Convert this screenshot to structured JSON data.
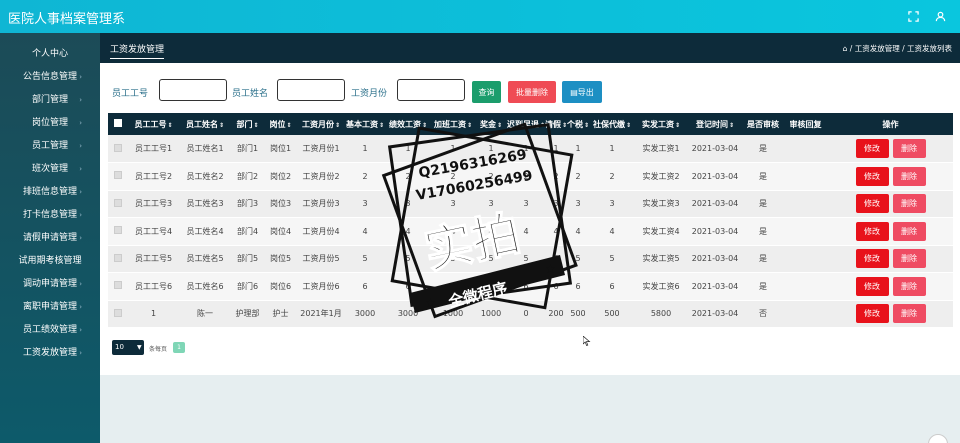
{
  "app": {
    "title": "医院人事档案管理系"
  },
  "sidebar": {
    "items": [
      {
        "label": "个人中心",
        "arrow": ""
      },
      {
        "label": "公告信息管理",
        "arrow": "›"
      },
      {
        "label": "部门管理",
        "arrow": "›"
      },
      {
        "label": "岗位管理",
        "arrow": "›"
      },
      {
        "label": "员工管理",
        "arrow": "›"
      },
      {
        "label": "班次管理",
        "arrow": "›"
      },
      {
        "label": "排班信息管理",
        "arrow": "›"
      },
      {
        "label": "打卡信息管理",
        "arrow": "›"
      },
      {
        "label": "请假申请管理",
        "arrow": "›"
      },
      {
        "label": "试用期考核管理",
        "arrow": "›"
      },
      {
        "label": "调动申请管理",
        "arrow": "›"
      },
      {
        "label": "离职申请管理",
        "arrow": "›"
      },
      {
        "label": "员工绩效管理",
        "arrow": "›"
      },
      {
        "label": "工资发放管理",
        "arrow": "›"
      }
    ]
  },
  "header": {
    "page_title": "工资发放管理",
    "breadcrumb": "⌂ / 工资发放管理 / 工资发放列表"
  },
  "search": {
    "emp_no_label": "员工工号",
    "emp_name_label": "员工姓名",
    "salary_month_label": "工资月份",
    "emp_no_value": "",
    "emp_name_value": "",
    "salary_month_value": "",
    "query_label": "查询",
    "batch_delete_label": "批量删除",
    "export_label": "导出",
    "export_icon": "document-icon"
  },
  "table": {
    "columns": [
      "员工工号",
      "员工姓名",
      "部门",
      "岗位",
      "工资月份",
      "基本工资",
      "绩效工资",
      "加班工资",
      "奖金",
      "迟到早退",
      "请假",
      "个税",
      "社保代缴",
      "实发工资",
      "登记时间",
      "是否审核",
      "审核回复",
      "操作"
    ],
    "edit_label": "修改",
    "delete_label": "删除",
    "rows": [
      [
        "员工工号1",
        "员工姓名1",
        "部门1",
        "岗位1",
        "工资月份1",
        "1",
        "1",
        "1",
        "1",
        "1",
        "1",
        "1",
        "1",
        "实发工资1",
        "2021-03-04",
        "是",
        ""
      ],
      [
        "员工工号2",
        "员工姓名2",
        "部门2",
        "岗位2",
        "工资月份2",
        "2",
        "2",
        "2",
        "2",
        "2",
        "2",
        "2",
        "2",
        "实发工资2",
        "2021-03-04",
        "是",
        ""
      ],
      [
        "员工工号3",
        "员工姓名3",
        "部门3",
        "岗位3",
        "工资月份3",
        "3",
        "3",
        "3",
        "3",
        "3",
        "3",
        "3",
        "3",
        "实发工资3",
        "2021-03-04",
        "是",
        ""
      ],
      [
        "员工工号4",
        "员工姓名4",
        "部门4",
        "岗位4",
        "工资月份4",
        "4",
        "4",
        "4",
        "4",
        "4",
        "4",
        "4",
        "4",
        "实发工资4",
        "2021-03-04",
        "是",
        ""
      ],
      [
        "员工工号5",
        "员工姓名5",
        "部门5",
        "岗位5",
        "工资月份5",
        "5",
        "5",
        "5",
        "5",
        "5",
        "5",
        "5",
        "5",
        "实发工资5",
        "2021-03-04",
        "是",
        ""
      ],
      [
        "员工工号6",
        "员工姓名6",
        "部门6",
        "岗位6",
        "工资月份6",
        "6",
        "6",
        "6",
        "6",
        "6",
        "6",
        "6",
        "6",
        "实发工资6",
        "2021-03-04",
        "是",
        ""
      ],
      [
        "1",
        "陈一",
        "护理部",
        "护士",
        "2021年1月",
        "3000",
        "3000",
        "1000",
        "1000",
        "0",
        "200",
        "500",
        "500",
        "5800",
        "2021-03-04",
        "否",
        ""
      ]
    ]
  },
  "pagination": {
    "page_size": "10",
    "per_page_label": "条每页",
    "current_page": "1"
  },
  "watermark": {
    "line1": "Q2196316269",
    "line2": "V17060256499",
    "big_text": "实拍",
    "banner_text": "全微程序"
  }
}
